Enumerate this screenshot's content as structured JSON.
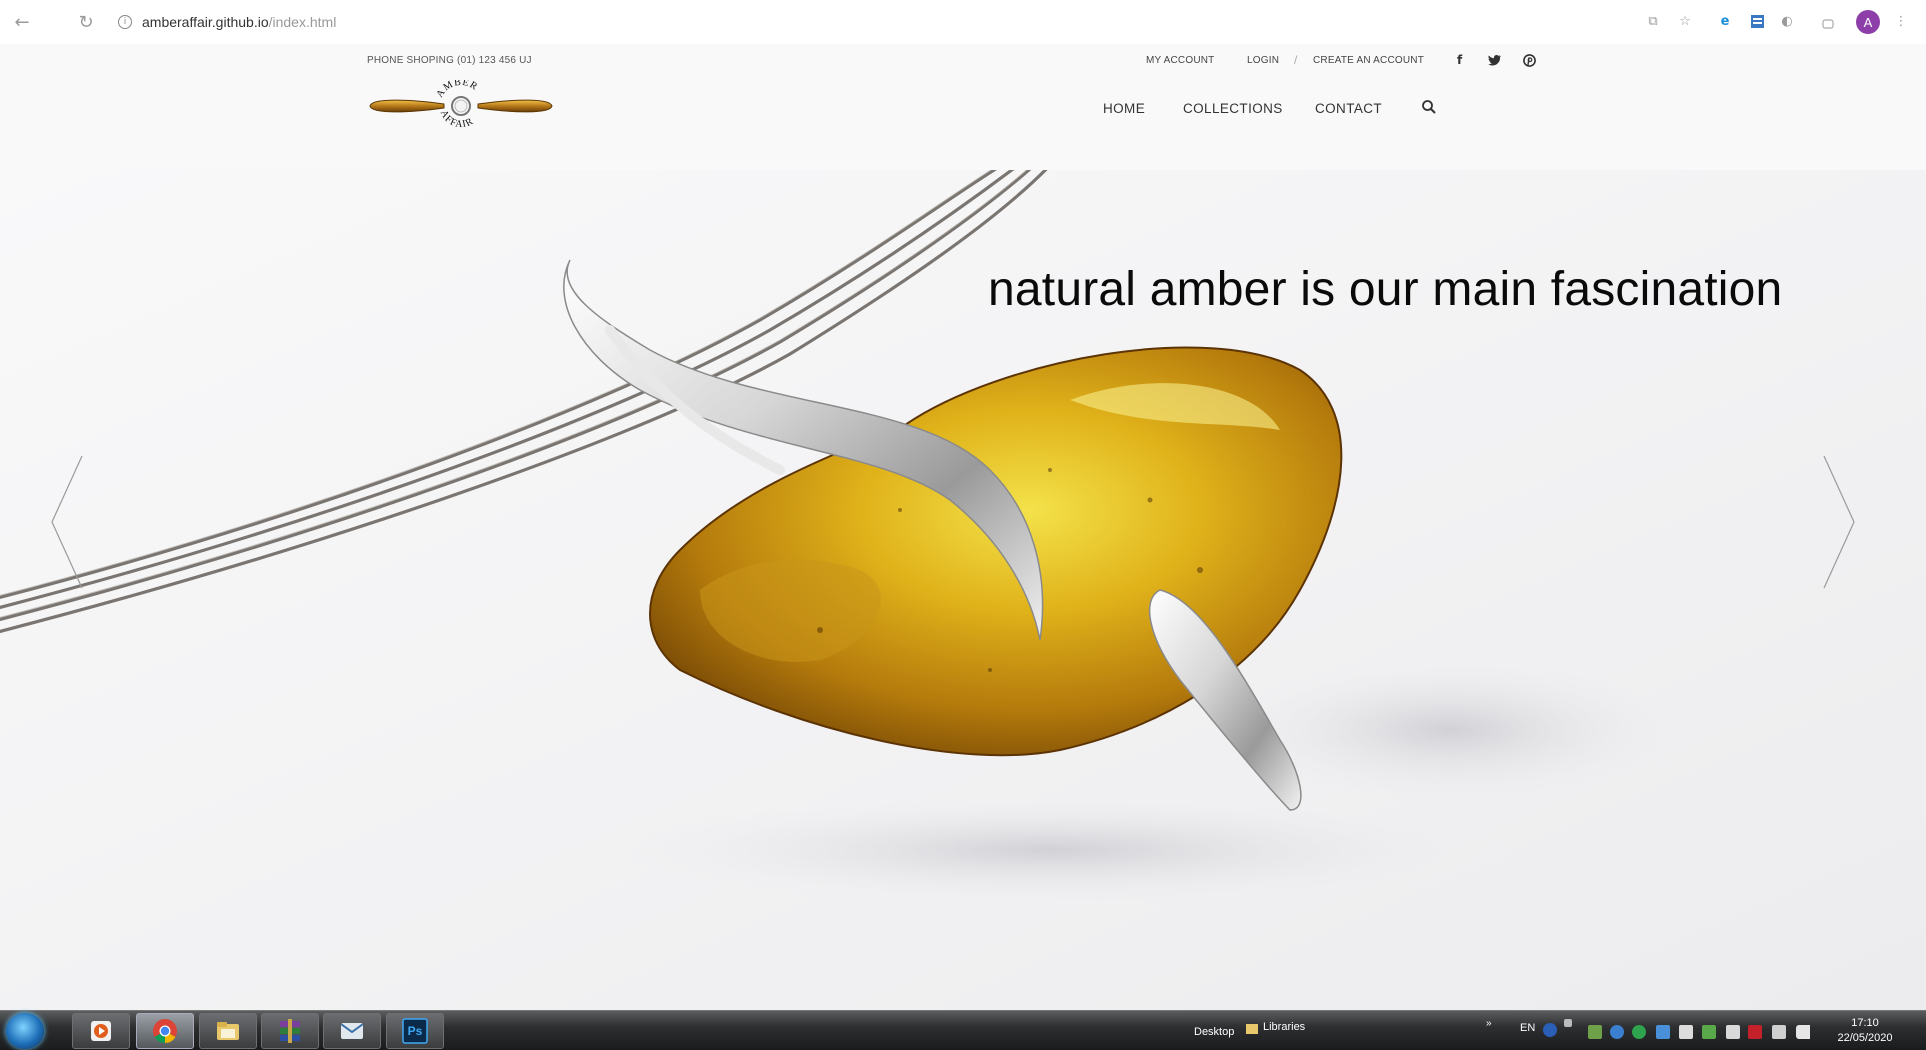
{
  "browser": {
    "url_host": "amberaffair.github.io",
    "url_path": "/index.html",
    "profile_initial": "A",
    "icons": [
      "back-icon",
      "reload-icon",
      "info-icon",
      "translate-icon",
      "star-icon",
      "edge-extension-icon",
      "extension-icon",
      "theme-extension-icon",
      "extension-badge-icon",
      "menu-dots-icon"
    ]
  },
  "site": {
    "phone": "PHONE SHOPING (01) 123 456 UJ",
    "top_links": {
      "my_account": "MY ACCOUNT",
      "login": "LOGIN",
      "separator": "/",
      "create_account": "CREATE AN ACCOUNT"
    },
    "social": [
      "facebook-icon",
      "twitter-icon",
      "pinterest-icon"
    ],
    "logo_text": "AMBER AFFAIR",
    "nav": {
      "home": "HOME",
      "collections": "COLLECTIONS",
      "contact": "CONTACT"
    }
  },
  "hero": {
    "headline": "natural amber is our main fascination",
    "prev_label": "previous-slide",
    "next_label": "next-slide",
    "colors": {
      "amber": "#c99a12",
      "amber_dark": "#8a5a08",
      "silver": "#dcdcdc"
    }
  },
  "taskbar": {
    "desktop_label": "Desktop",
    "libraries_label": "Libraries",
    "lang": "EN",
    "time": "17:10",
    "date": "22/05/2020",
    "apps": [
      "media-player-icon",
      "chrome-icon",
      "file-explorer-icon",
      "winrar-icon",
      "outlook-icon",
      "photoshop-icon"
    ],
    "photoshop_label": "Ps"
  }
}
